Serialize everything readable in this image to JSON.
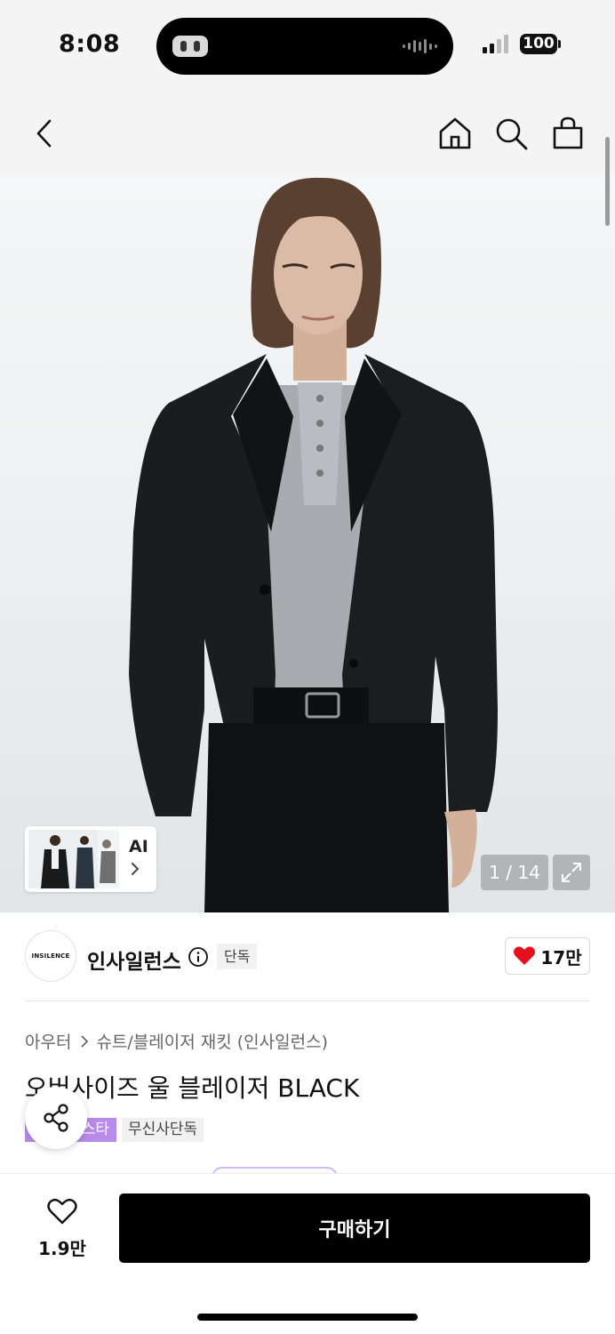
{
  "status_bar": {
    "time": "8:08",
    "battery": "100"
  },
  "nav": {
    "icons": [
      "back-icon",
      "home-icon",
      "search-icon",
      "cart-icon"
    ]
  },
  "gallery": {
    "counter": "1 / 14",
    "ai_label": "AI"
  },
  "brand": {
    "logo_text": "INSILENCE",
    "name": "인사일런스",
    "exclusive_tag": "단독",
    "like_count": "17만",
    "heart_color": "#e5101d"
  },
  "product": {
    "breadcrumb": [
      "아우터",
      "슈트/블레이저 재킷 (인사일런스)"
    ],
    "title": "오버사이즈 울 블레이저 BLACK",
    "tags": [
      "스타",
      "무신사단독"
    ]
  },
  "bottom_bar": {
    "wish_count": "1.9만",
    "buy_label": "구매하기"
  }
}
